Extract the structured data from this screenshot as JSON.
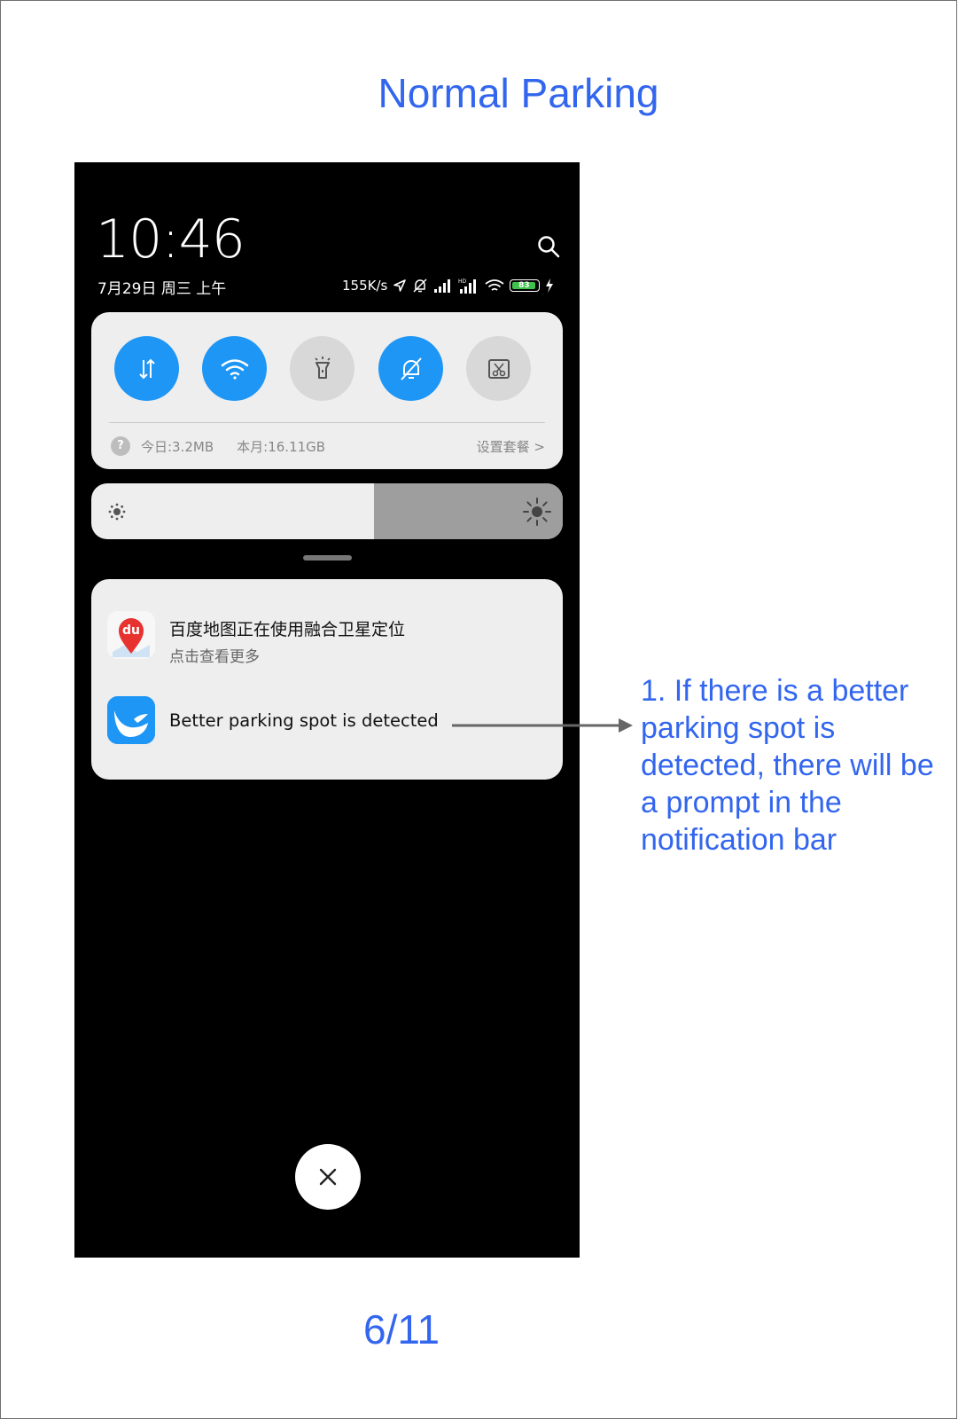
{
  "slide": {
    "title": "Normal Parking",
    "page": "6/11",
    "annotation": "1. If there is a better parking spot is detected, there will be a prompt in the notification bar"
  },
  "status_bar": {
    "time": "10:46",
    "date": "7月29日 周三 上午",
    "net_speed": "155K/s",
    "battery": "83",
    "accent_color": "#1e96f5"
  },
  "quick_settings": {
    "toggles": [
      {
        "name": "mobile-data",
        "icon": "data-arrows-icon",
        "state": "on"
      },
      {
        "name": "wifi",
        "icon": "wifi-icon",
        "state": "on"
      },
      {
        "name": "flashlight",
        "icon": "flashlight-icon",
        "state": "off"
      },
      {
        "name": "silent",
        "icon": "bell-off-icon",
        "state": "on"
      },
      {
        "name": "screenshot",
        "icon": "screenshot-icon",
        "state": "off"
      }
    ],
    "data_today": "今日:3.2MB",
    "data_month": "本月:16.11GB",
    "data_settings": "设置套餐 >"
  },
  "brightness": {
    "level": 0.6
  },
  "notifications": [
    {
      "app": "baidu-maps",
      "icon_text": "du",
      "title": "百度地图正在使用融合卫星定位",
      "subtitle": "点击查看更多"
    },
    {
      "app": "parking-app",
      "title": "Better parking spot is detected"
    }
  ]
}
